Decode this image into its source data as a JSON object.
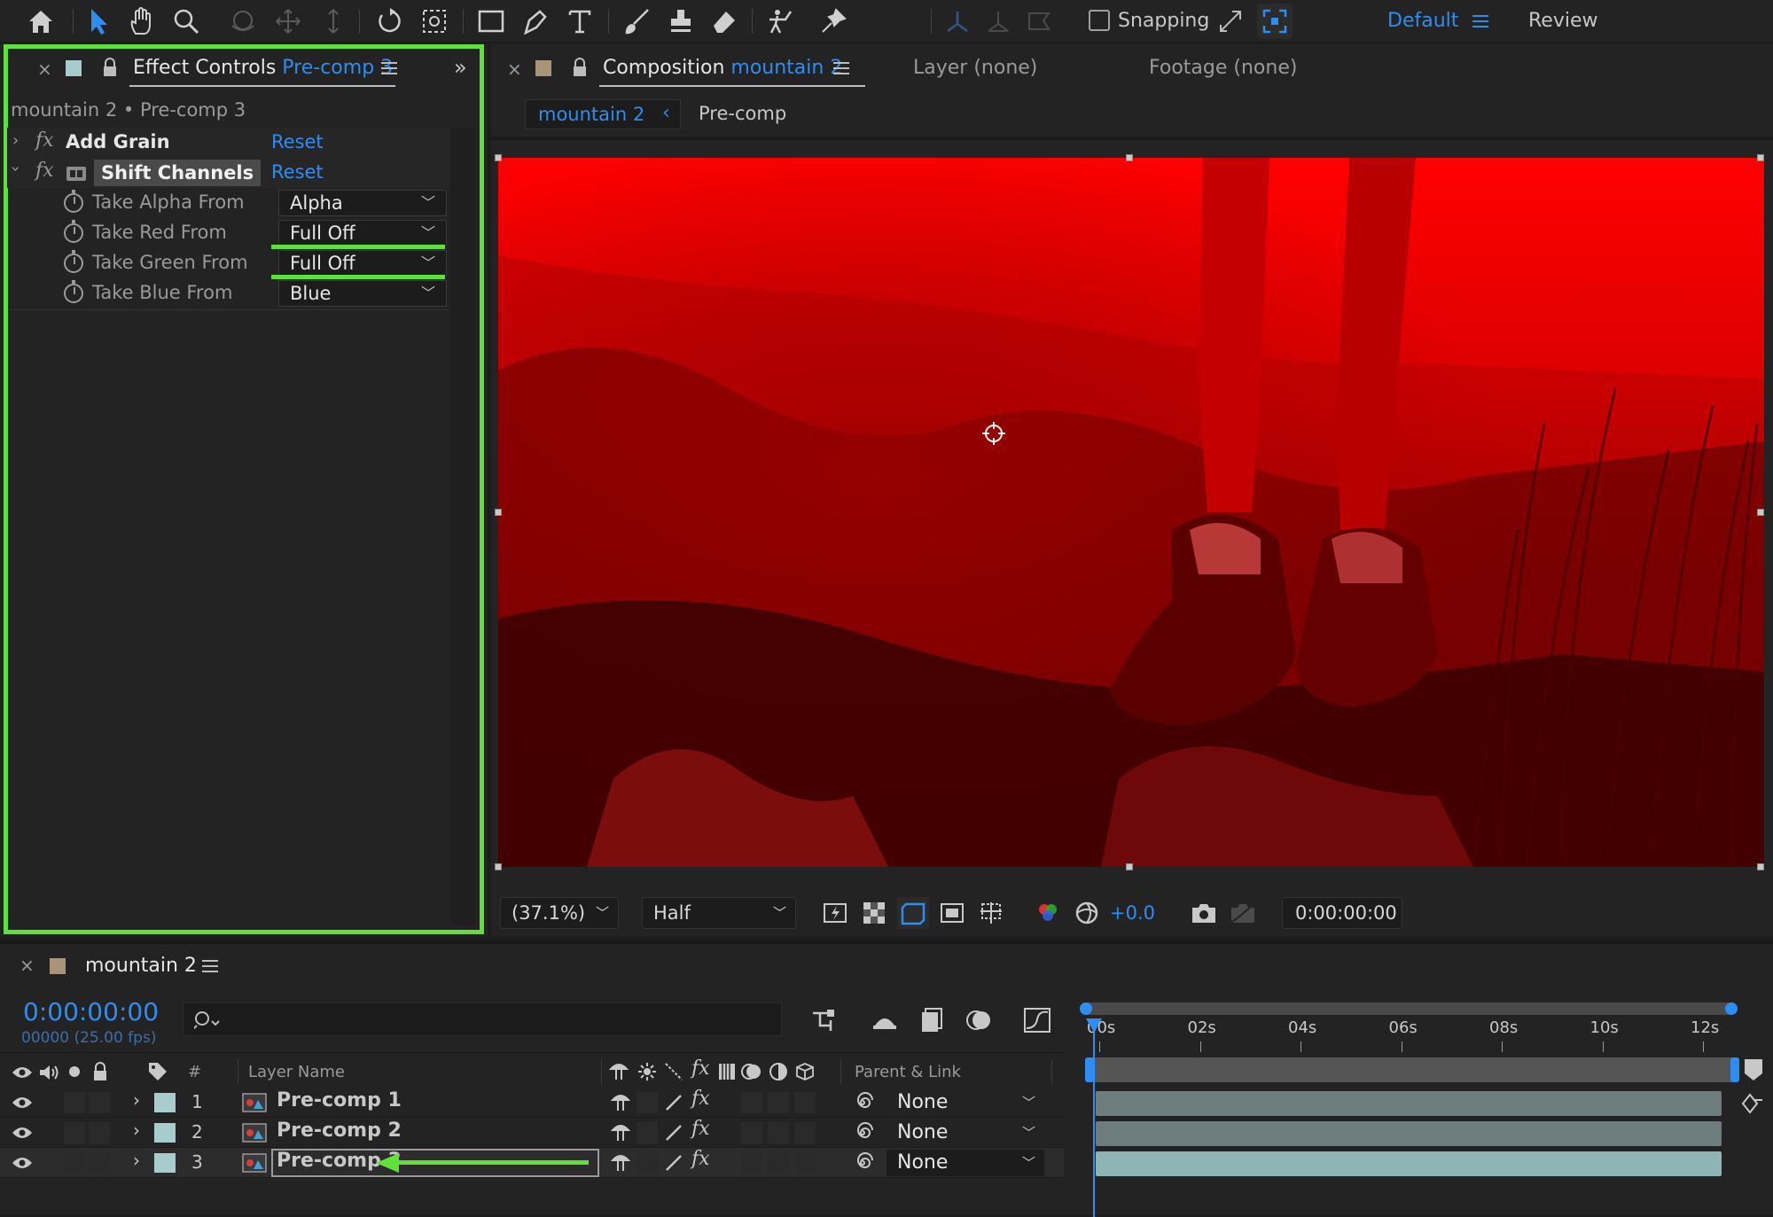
{
  "toolbar": {
    "snapping_label": "Snapping",
    "workspace_default": "Default",
    "workspace_review": "Review"
  },
  "effect_panel": {
    "tab_prefix": "Effect Controls",
    "tab_target": "Pre-comp 3",
    "breadcrumb": "mountain 2 • Pre-comp 3",
    "effects": [
      {
        "name": "Add Grain",
        "reset": "Reset"
      },
      {
        "name": "Shift Channels",
        "reset": "Reset"
      }
    ],
    "properties": [
      {
        "label": "Take Alpha From",
        "value": "Alpha"
      },
      {
        "label": "Take Red From",
        "value": "Full Off"
      },
      {
        "label": "Take Green From",
        "value": "Full Off"
      },
      {
        "label": "Take Blue From",
        "value": "Blue"
      }
    ],
    "highlight_color": "#5fe03a"
  },
  "composition_panel": {
    "tab_prefix": "Composition",
    "tab_target": "mountain 2",
    "layer_tab": "Layer (none)",
    "footage_tab": "Footage (none)",
    "crumb_active": "mountain 2",
    "crumb_next": "Pre-comp",
    "zoom": "(37.1%)",
    "resolution": "Half",
    "exposure": "+0.0",
    "timecode": "0:00:00:00",
    "viewer_tint": "#ff0000"
  },
  "timeline": {
    "tab_label": "mountain 2",
    "current_time": "0:00:00:00",
    "frame_info": "00000 (25.00 fps)",
    "col_number": "#",
    "col_layer_name": "Layer Name",
    "col_parent": "Parent & Link",
    "ruler": [
      "00s",
      "02s",
      "04s",
      "06s",
      "08s",
      "10s",
      "12s"
    ],
    "layers": [
      {
        "num": "1",
        "name": "Pre-comp 1",
        "parent": "None"
      },
      {
        "num": "2",
        "name": "Pre-comp 2",
        "parent": "None"
      },
      {
        "num": "3",
        "name": "Pre-comp 3",
        "parent": "None"
      }
    ],
    "bar_color": "#6d7c7c",
    "playhead_color": "#2e8df0"
  }
}
